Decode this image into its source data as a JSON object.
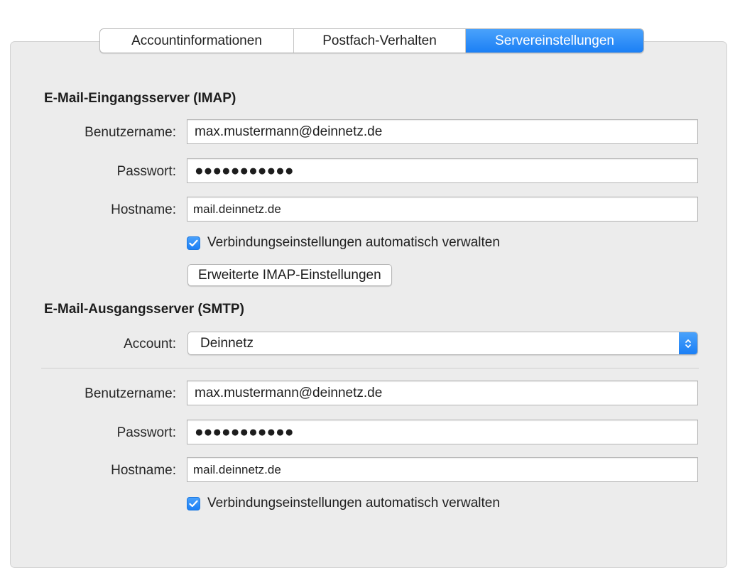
{
  "tabs": [
    {
      "label": "Accountinformationen",
      "active": false
    },
    {
      "label": "Postfach-Verhalten",
      "active": false
    },
    {
      "label": "Servereinstellungen",
      "active": true
    }
  ],
  "incoming": {
    "title": "E-Mail-Eingangsserver (IMAP)",
    "username_label": "Benutzername:",
    "username_value": "max.mustermann@deinnetz.de",
    "password_label": "Passwort:",
    "password_value": "●●●●●●●●●●●",
    "hostname_label": "Hostname:",
    "hostname_value": "mail.deinnetz.de",
    "auto_manage_label": "Verbindungseinstellungen automatisch verwalten",
    "auto_manage_checked": true,
    "advanced_button": "Erweiterte IMAP-Einstellungen"
  },
  "outgoing": {
    "title": "E-Mail-Ausgangsserver (SMTP)",
    "account_label": "Account:",
    "account_value": "Deinnetz",
    "username_label": "Benutzername:",
    "username_value": "max.mustermann@deinnetz.de",
    "password_label": "Passwort:",
    "password_value": "●●●●●●●●●●●",
    "hostname_label": "Hostname:",
    "hostname_value": "mail.deinnetz.de",
    "auto_manage_label": "Verbindungseinstellungen automatisch verwalten",
    "auto_manage_checked": true
  },
  "colors": {
    "accent": "#1b7ff5",
    "panel_background": "#ececec"
  },
  "icons": {
    "checkbox": "checkmark-icon",
    "select": "up-down-chevron-icon"
  }
}
